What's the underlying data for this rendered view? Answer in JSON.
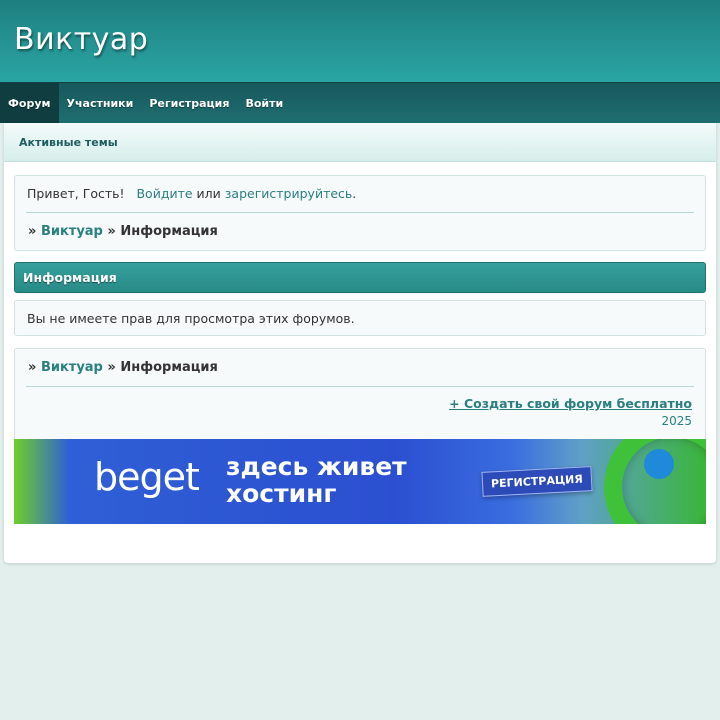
{
  "site": {
    "title": "Виктуар"
  },
  "nav": {
    "items": [
      {
        "label": "Форум",
        "active": true
      },
      {
        "label": "Участники"
      },
      {
        "label": "Регистрация"
      },
      {
        "label": "Войти"
      }
    ]
  },
  "subnav": {
    "active_topics": "Активные темы"
  },
  "welcome": {
    "greeting": "Привет, Гость!",
    "login": "Войдите",
    "or": "или",
    "register": "зарегистрируйтесь",
    "period": "."
  },
  "breadcrumb": {
    "sep": "»",
    "forum": "Виктуар",
    "current": "Информация"
  },
  "info": {
    "heading": "Информация",
    "message": "Вы не имеете прав для просмотра этих форумов."
  },
  "footer": {
    "create_forum": "+ Создать свой форум бесплатно",
    "year": "2025"
  },
  "banner": {
    "logo": "beget",
    "line1": "здесь живет",
    "line2": "хостинг",
    "button": "РЕГИСТРАЦИЯ"
  },
  "colors": {
    "header": "#2aa5a3",
    "nav": "#1f6e70",
    "link": "#2a7f80",
    "background": "#e2efed"
  }
}
